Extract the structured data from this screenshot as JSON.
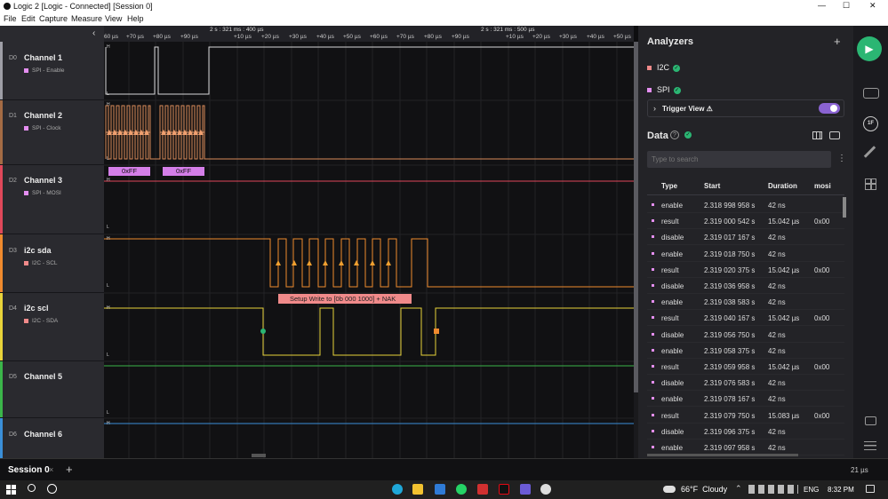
{
  "app": {
    "title": "Logic 2 [Logic - Connected] [Session 0]",
    "window_controls": [
      "—",
      "☐",
      "✕"
    ]
  },
  "menu": [
    "File",
    "Edit",
    "Capture",
    "Measure",
    "View",
    "Help"
  ],
  "ruler": {
    "group_left": "2 s : 321 ms : 400 µs",
    "group_right": "2 s : 321 ms : 500 µs",
    "ticks": [
      "60 µs",
      "+70 µs",
      "+80 µs",
      "+90 µs",
      "+10 µs",
      "+20 µs",
      "+30 µs",
      "+40 µs",
      "+50 µs",
      "+60 µs",
      "+70 µs",
      "+80 µs",
      "+90 µs",
      "+10 µs",
      "+20 µs",
      "+30 µs",
      "+40 µs",
      "+50 µs"
    ]
  },
  "channels": [
    {
      "d": "D0",
      "name": "Channel 1",
      "sub": "SPI - Enable",
      "color": "#9e9ea6",
      "sub_color": "#e48ef0"
    },
    {
      "d": "D1",
      "name": "Channel 2",
      "sub": "SPI - Clock",
      "color": "#a46b44",
      "sub_color": "#e48ef0"
    },
    {
      "d": "D2",
      "name": "Channel 3",
      "sub": "SPI - MOSI",
      "color": "#e0485a",
      "sub_color": "#e48ef0"
    },
    {
      "d": "D3",
      "name": "i2c sda",
      "sub": "I2C - SCL",
      "color": "#f08a2e",
      "sub_color": "#f08a8a"
    },
    {
      "d": "D4",
      "name": "i2c scl",
      "sub": "I2C - SDA",
      "color": "#e8d33a",
      "sub_color": "#f08a8a"
    },
    {
      "d": "D5",
      "name": "Channel 5",
      "sub": "",
      "color": "#3bb54a",
      "sub_color": ""
    },
    {
      "d": "D6",
      "name": "Channel 6",
      "sub": "",
      "color": "#3a8fd8",
      "sub_color": ""
    }
  ],
  "wave_labels": {
    "h": "H",
    "l": "L",
    "mosi_1": "0xFF",
    "mosi_2": "0xFF",
    "i2c_annotation": "Setup Write to [0b 000 1000] + NAK"
  },
  "analyzers": {
    "title": "Analyzers",
    "add": "+",
    "items": [
      {
        "label": "I2C",
        "color": "#f08a8a"
      },
      {
        "label": "SPI",
        "color": "#e48ef0"
      }
    ],
    "trigger_view": "Trigger View ⚠",
    "trigger_enabled": true
  },
  "data": {
    "title": "Data",
    "search_placeholder": "Type to search",
    "columns": [
      "Type",
      "Start",
      "Duration",
      "mosi"
    ],
    "rows": [
      {
        "type": "enable",
        "start": "2.318 998 958 s",
        "duration": "42 ns",
        "mosi": ""
      },
      {
        "type": "result",
        "start": "2.319 000 542 s",
        "duration": "15.042 µs",
        "mosi": "0x00"
      },
      {
        "type": "disable",
        "start": "2.319 017 167 s",
        "duration": "42 ns",
        "mosi": ""
      },
      {
        "type": "enable",
        "start": "2.319 018 750 s",
        "duration": "42 ns",
        "mosi": ""
      },
      {
        "type": "result",
        "start": "2.319 020 375 s",
        "duration": "15.042 µs",
        "mosi": "0x00"
      },
      {
        "type": "disable",
        "start": "2.319 036 958 s",
        "duration": "42 ns",
        "mosi": ""
      },
      {
        "type": "enable",
        "start": "2.319 038 583 s",
        "duration": "42 ns",
        "mosi": ""
      },
      {
        "type": "result",
        "start": "2.319 040 167 s",
        "duration": "15.042 µs",
        "mosi": "0x00"
      },
      {
        "type": "disable",
        "start": "2.319 056 750 s",
        "duration": "42 ns",
        "mosi": ""
      },
      {
        "type": "enable",
        "start": "2.319 058 375 s",
        "duration": "42 ns",
        "mosi": ""
      },
      {
        "type": "result",
        "start": "2.319 059 958 s",
        "duration": "15.042 µs",
        "mosi": "0x00"
      },
      {
        "type": "disable",
        "start": "2.319 076 583 s",
        "duration": "42 ns",
        "mosi": ""
      },
      {
        "type": "enable",
        "start": "2.319 078 167 s",
        "duration": "42 ns",
        "mosi": ""
      },
      {
        "type": "result",
        "start": "2.319 079 750 s",
        "duration": "15.083 µs",
        "mosi": "0x00"
      },
      {
        "type": "disable",
        "start": "2.319 096 375 s",
        "duration": "42 ns",
        "mosi": ""
      },
      {
        "type": "enable",
        "start": "2.319 097 958 s",
        "duration": "42 ns",
        "mosi": ""
      }
    ]
  },
  "rightbar": {
    "play": "▶",
    "badge": "1F"
  },
  "session": {
    "tab": "Session 0",
    "close": "×",
    "add": "+",
    "zoom": "21 µs"
  },
  "taskbar": {
    "weather": "66°F  Cloudy",
    "lang": "ENG",
    "time": "8:32 PM"
  }
}
